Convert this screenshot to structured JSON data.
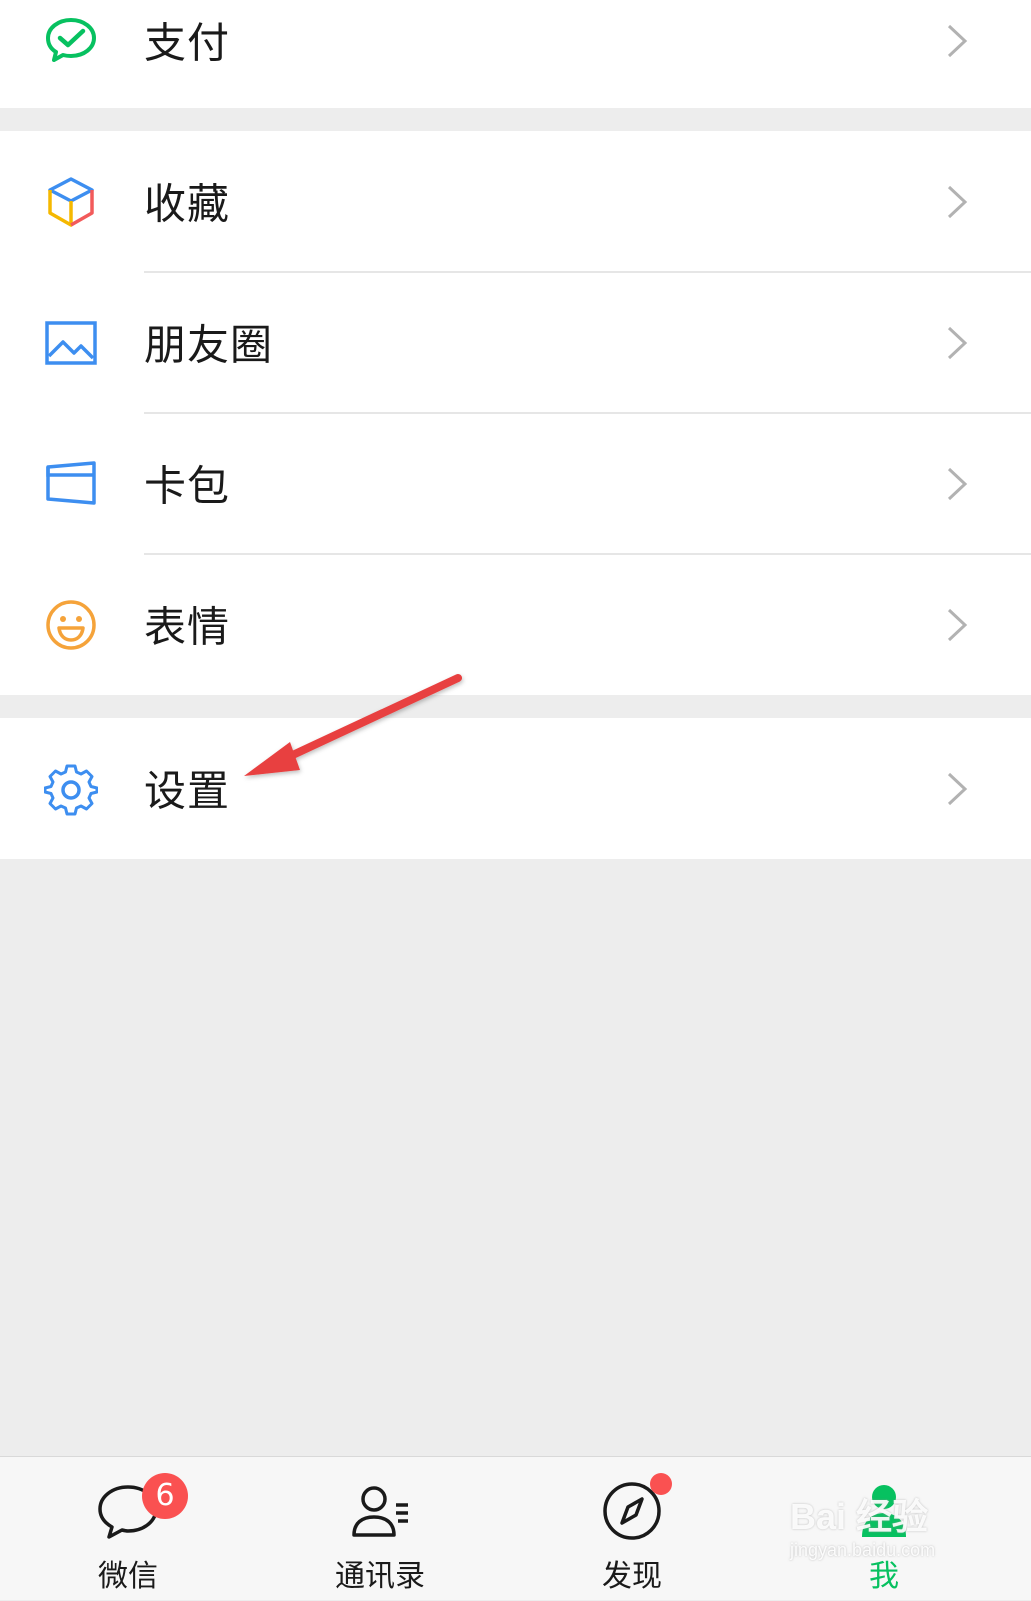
{
  "menu": {
    "groups": [
      {
        "items": [
          {
            "label": "支付",
            "icon": "wechat-pay-icon"
          }
        ]
      },
      {
        "items": [
          {
            "label": "收藏",
            "icon": "favorites-cube-icon"
          },
          {
            "label": "朋友圈",
            "icon": "moments-picture-icon"
          },
          {
            "label": "卡包",
            "icon": "card-wallet-icon"
          },
          {
            "label": "表情",
            "icon": "sticker-smile-icon"
          }
        ]
      },
      {
        "items": [
          {
            "label": "设置",
            "icon": "settings-gear-icon"
          }
        ]
      }
    ]
  },
  "tabbar": {
    "tabs": [
      {
        "label": "微信",
        "icon": "chat-bubble-icon",
        "badge": "6"
      },
      {
        "label": "通讯录",
        "icon": "contacts-icon"
      },
      {
        "label": "发现",
        "icon": "compass-icon",
        "dot": true
      },
      {
        "label": "我",
        "icon": "me-person-icon",
        "active": true
      }
    ]
  },
  "watermark": {
    "logo_text": "Bai 经验",
    "url": "jingyan.baidu.com"
  },
  "colors": {
    "accent_green": "#07c160",
    "badge_red": "#fa5151",
    "annotation_arrow": "#e84040",
    "page_bg": "#ededed"
  }
}
